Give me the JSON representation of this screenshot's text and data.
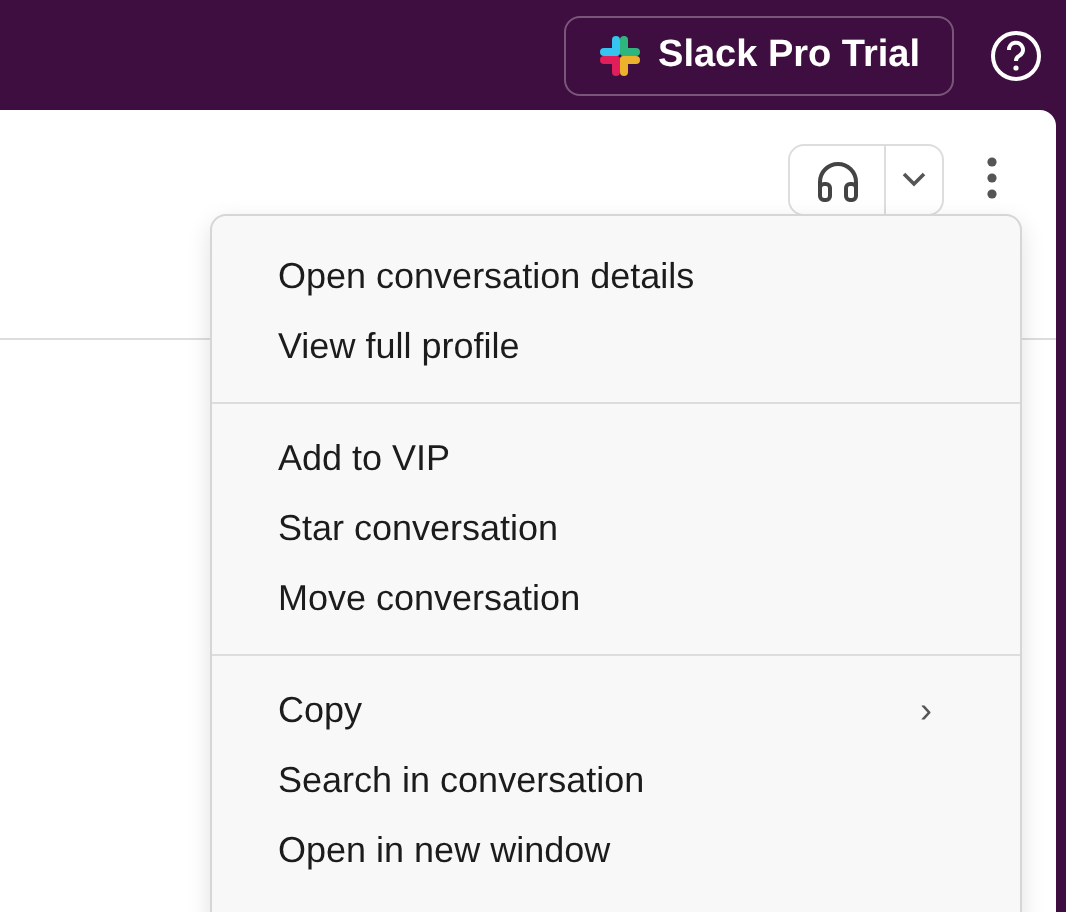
{
  "top_bar": {
    "trial_button": {
      "label": "Slack Pro Trial"
    }
  },
  "menu": {
    "sections": [
      [
        {
          "label": "Open conversation details"
        },
        {
          "label": "View full profile"
        }
      ],
      [
        {
          "label": "Add to VIP"
        },
        {
          "label": "Star conversation"
        },
        {
          "label": "Move conversation"
        }
      ],
      [
        {
          "label": "Copy",
          "submenu_arrow": "›"
        },
        {
          "label": "Search in conversation"
        },
        {
          "label": "Open in new window"
        }
      ]
    ]
  }
}
